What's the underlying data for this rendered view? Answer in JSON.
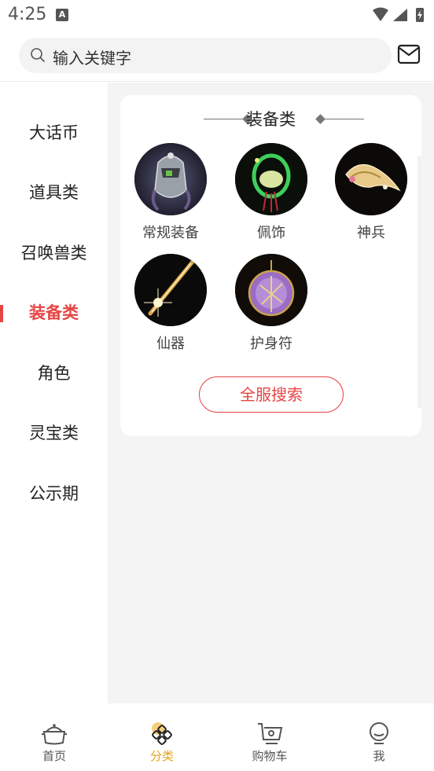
{
  "status": {
    "time": "4:25",
    "badge": "A"
  },
  "search": {
    "placeholder": "输入关键字"
  },
  "sidebar": {
    "items": [
      {
        "label": "大话币"
      },
      {
        "label": "道具类"
      },
      {
        "label": "召唤兽类"
      },
      {
        "label": "装备类"
      },
      {
        "label": "角色"
      },
      {
        "label": "灵宝类"
      },
      {
        "label": "公示期"
      }
    ],
    "active_index": 3
  },
  "main": {
    "category_title": "装备类",
    "items": [
      {
        "label": "常规装备",
        "icon": "helmet-icon"
      },
      {
        "label": "佩饰",
        "icon": "jade-pendant-icon"
      },
      {
        "label": "神兵",
        "icon": "divine-weapon-icon"
      },
      {
        "label": "仙器",
        "icon": "sword-icon"
      },
      {
        "label": "护身符",
        "icon": "amulet-icon"
      }
    ],
    "search_all_label": "全服搜索"
  },
  "bottom_nav": {
    "items": [
      {
        "label": "首页",
        "icon": "home-icon"
      },
      {
        "label": "分类",
        "icon": "category-icon"
      },
      {
        "label": "购物车",
        "icon": "cart-icon"
      },
      {
        "label": "我",
        "icon": "profile-icon"
      }
    ],
    "active_index": 1
  },
  "colors": {
    "accent": "#e64545",
    "nav_active": "#e3a320"
  }
}
